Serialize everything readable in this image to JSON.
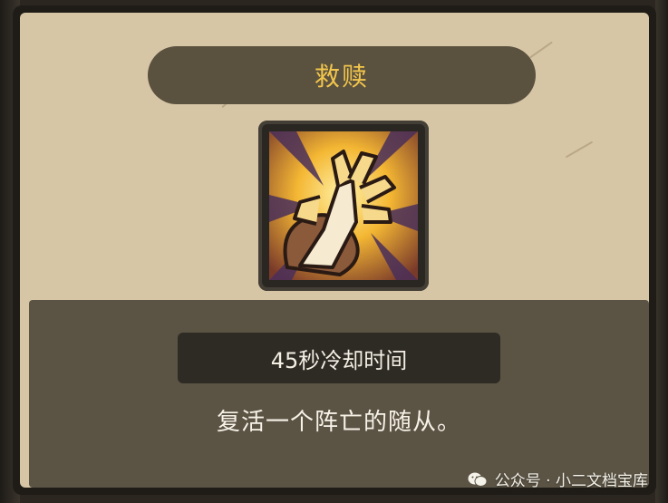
{
  "ability": {
    "title": "救赎",
    "cooldown": "45秒冷却时间",
    "description": "复活一个阵亡的随从。",
    "icon": "rising-hand-icon"
  },
  "watermark": {
    "text": "公众号 · 小二文档宝库",
    "icon": "wechat-logo-icon"
  },
  "colors": {
    "title_text": "#f2c64c",
    "parchment": "#d7c6a6",
    "title_bar": "#5a513f",
    "desc_panel": "#5b5445",
    "cooldown_bar": "#2e2a24"
  }
}
